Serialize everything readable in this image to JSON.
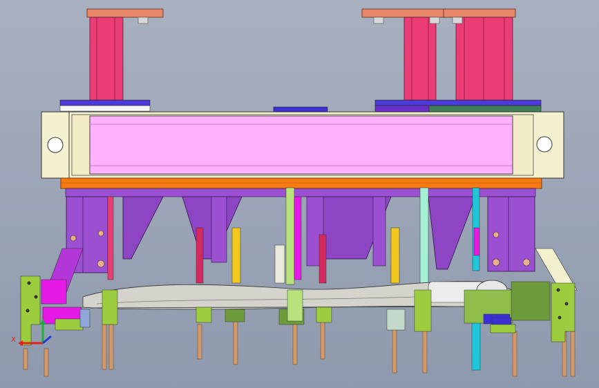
{
  "viewport": {
    "background_top": "#a9b1c0",
    "background_bottom": "#8f99ad"
  },
  "triad": {
    "x_label": "X",
    "x_color": "#e2231a",
    "y_color": "#1fae3a",
    "z_color": "#1d3fcf"
  },
  "colors": {
    "beam": "#ffb0ff",
    "end_plate": "#f3f1cf",
    "cylinder": "#ea3d76",
    "cylinder_cap": "#e58668",
    "rail": "#f57a14",
    "bracket": "#9b4fd1",
    "pin": "#d09a6c",
    "panel_part": "#d4d4cc",
    "clamp_green": "#9ccd3f",
    "accent_cyan": "#1fc6d9",
    "accent_magenta": "#e51ae6",
    "accent_blue": "#3b2fd6",
    "accent_yellow": "#f2c81f"
  }
}
